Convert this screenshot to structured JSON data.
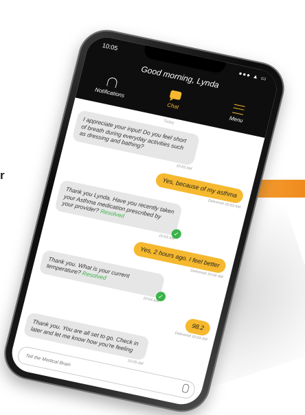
{
  "side_text": "r",
  "status": {
    "time": "10:05",
    "icons": "●●● ▲ ▭"
  },
  "header": {
    "greeting": "Good morning, Lynda"
  },
  "nav": {
    "items": [
      {
        "label": "Notifications",
        "icon": "bell-icon"
      },
      {
        "label": "Chat",
        "icon": "chat-icon"
      },
      {
        "label": "Menu",
        "icon": "menu-icon"
      }
    ],
    "active": "Chat"
  },
  "chat": {
    "date_label": "Today",
    "messages": [
      {
        "text": "I appreciate your input! Do you feel short of breath during everyday  activities such as dressing and bathing?",
        "time": "10:03 AM"
      },
      {
        "text": "Yes, because of my asthma",
        "status": "Delivered 10:03 AM"
      },
      {
        "text": "Thank you Lynda. Have you recently taken your Asthma medication prescribed by your provider?",
        "resolved": "Resolved",
        "time": "10:03 AM"
      },
      {
        "text": "Yes, 2 hours ago. I feel better",
        "status": "Delivered 10:04 AM"
      },
      {
        "text": "Thank you. What is your current temperature?",
        "resolved": "Resolved",
        "time": "10:04 AM"
      },
      {
        "text": "98.2",
        "status": "Delivered 10:04 AM"
      },
      {
        "text": "Thank you. You are all set to go. Check in later and let me know how you're feeling",
        "time": "10:05 AM"
      }
    ]
  },
  "composer": {
    "placeholder": "Tell the Medical Brain",
    "icon": "microphone-icon"
  },
  "colors": {
    "accent": "#f5b82e",
    "resolved": "#3bb34a",
    "bar": "#ef8a1d",
    "header_bg": "#0e0e0e"
  }
}
